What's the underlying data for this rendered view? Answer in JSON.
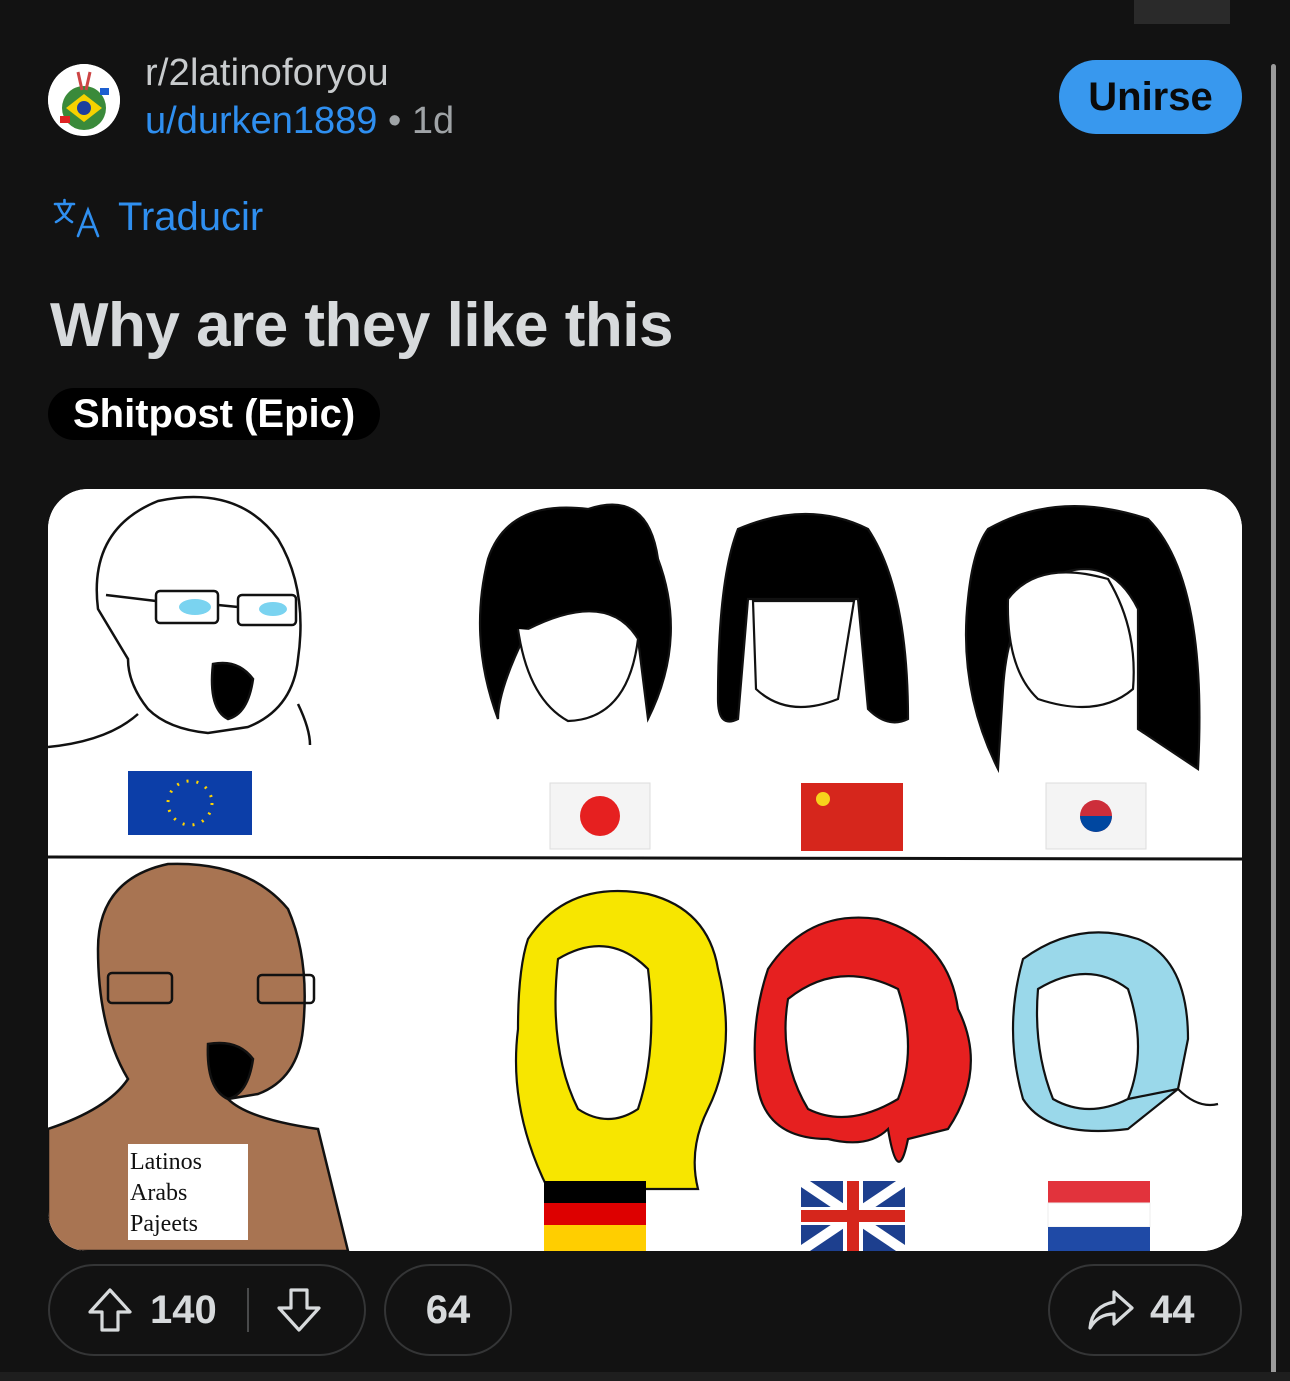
{
  "header": {
    "subreddit": "r/2latinoforyou",
    "username": "u/durken1889",
    "separator": "•",
    "age": "1d",
    "join_label": "Unirse"
  },
  "translate": {
    "icon": "translate-icon",
    "label": "Traducir"
  },
  "post": {
    "title": "Why are they like this",
    "flair": "Shitpost (Epic)",
    "image": {
      "description_icon": "meme-image",
      "sign_lines": [
        "Latinos",
        "Arabs",
        "Pajeets"
      ]
    }
  },
  "actions": {
    "upvote_icon": "upvote-arrow-icon",
    "score": "140",
    "downvote_icon": "downvote-arrow-icon",
    "comments": "64",
    "share_icon": "share-arrow-icon",
    "shares": "44"
  },
  "colors": {
    "background": "#121212",
    "accent": "#3898ee",
    "link": "#2f8ff0"
  }
}
